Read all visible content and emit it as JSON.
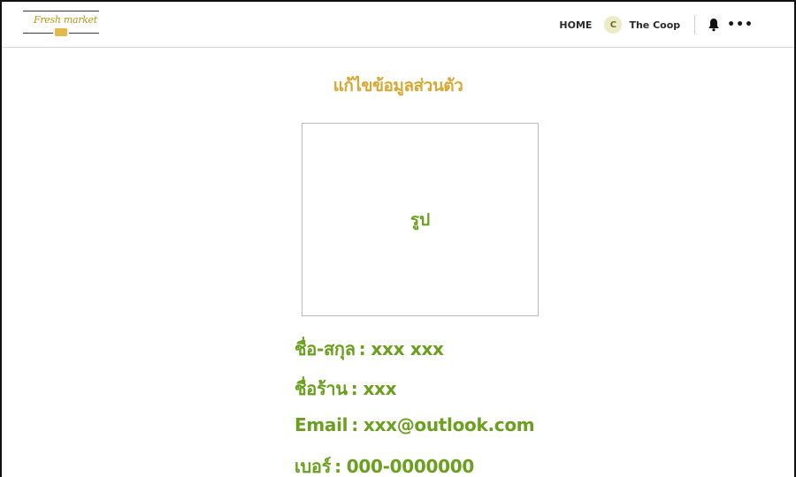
{
  "brand": {
    "logo_text": "Fresh market"
  },
  "nav": {
    "home_label": "HOME",
    "avatar_initial": "C",
    "user_name": "The Coop",
    "more_label": "•••",
    "icons": [
      "bell-icon",
      "more-icon"
    ]
  },
  "main": {
    "title": "แก้ไขข้อมูลส่วนตัว",
    "photo_label": "รูป",
    "fields": [
      {
        "label": "ชื่อ-สกุล",
        "value": "xxx xxx"
      },
      {
        "label": "ชื่อร้าน",
        "value": "xxx"
      },
      {
        "label": "Email",
        "value": "xxx@outlook.com"
      },
      {
        "label": "เบอร์",
        "value": "000-0000000"
      }
    ]
  },
  "colors": {
    "title_gold": "#d7a934",
    "field_green": "#6aa01e",
    "avatar_bg": "#ecebc8"
  }
}
